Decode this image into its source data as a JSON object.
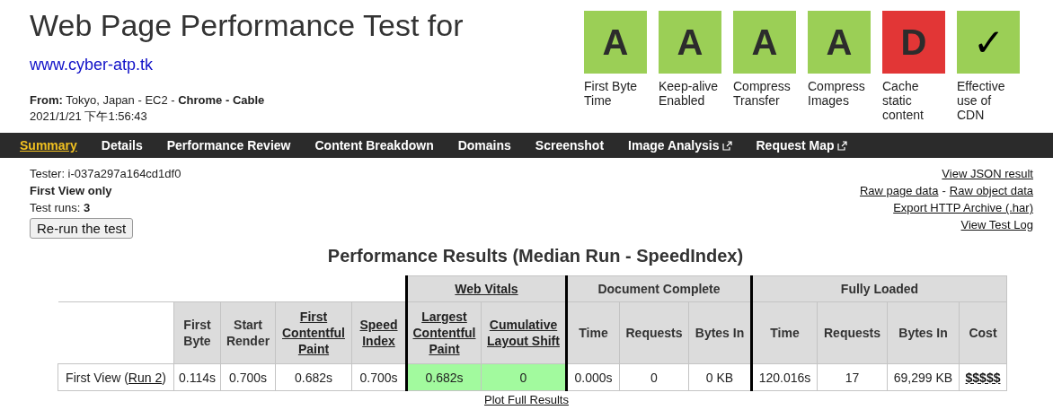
{
  "header": {
    "title": "Web Page Performance Test for",
    "url": "www.cyber-atp.tk",
    "from": "**From:** Tokyo, Japan - EC2 - **Chrome - Cable**",
    "date": "2021/1/21 下午1:56:43"
  },
  "grades": [
    {
      "symbol": "A",
      "label": "First Byte Time",
      "color": "#9bcf56"
    },
    {
      "symbol": "A",
      "label": "Keep-alive Enabled",
      "color": "#9bcf56"
    },
    {
      "symbol": "A",
      "label": "Compress Transfer",
      "color": "#9bcf56"
    },
    {
      "symbol": "A",
      "label": "Compress Images",
      "color": "#9bcf56"
    },
    {
      "symbol": "D",
      "label": "Cache static content",
      "color": "#e23636"
    },
    {
      "symbol": "✓",
      "label": "Effective use of CDN",
      "color": "#9bcf56"
    }
  ],
  "tabs": [
    {
      "label": "Summary",
      "selected": true,
      "external": false
    },
    {
      "label": "Details",
      "selected": false,
      "external": false
    },
    {
      "label": "Performance Review",
      "selected": false,
      "external": false
    },
    {
      "label": "Content Breakdown",
      "selected": false,
      "external": false
    },
    {
      "label": "Domains",
      "selected": false,
      "external": false
    },
    {
      "label": "Screenshot",
      "selected": false,
      "external": false
    },
    {
      "label": "Image Analysis",
      "selected": false,
      "external": true
    },
    {
      "label": "Request Map",
      "selected": false,
      "external": true
    }
  ],
  "info": {
    "tester": "Tester: i-037a297a164cd1df0",
    "view": "First View only",
    "runs": "Test runs: **3**",
    "button": "Re-run the test"
  },
  "links": [
    [
      "View JSON result"
    ],
    [
      "Raw page data",
      "Raw object data"
    ],
    [
      "Export HTTP Archive (.har)"
    ],
    [
      "View Test Log"
    ]
  ],
  "link_separator": "-",
  "results": {
    "title": "Performance Results (Median Run - SpeedIndex)",
    "columns": [
      {
        "label": "First Byte",
        "link": false
      },
      {
        "label": "Start Render",
        "link": false
      },
      {
        "label": "First Contentful Paint",
        "link": true
      },
      {
        "label": "Speed Index",
        "link": true
      }
    ],
    "groups": [
      {
        "label": "Web Vitals",
        "link": true,
        "columns": [
          {
            "label": "Largest Contentful Paint",
            "link": true
          },
          {
            "label": "Cumulative Layout Shift",
            "link": true
          }
        ]
      },
      {
        "label": "Document Complete",
        "link": false,
        "columns": [
          {
            "label": "Time",
            "link": false
          },
          {
            "label": "Requests",
            "link": false
          },
          {
            "label": "Bytes In",
            "link": false
          }
        ]
      },
      {
        "label": "Fully Loaded",
        "link": false,
        "columns": [
          {
            "label": "Time",
            "link": false
          },
          {
            "label": "Requests",
            "link": false
          },
          {
            "label": "Bytes In",
            "link": false
          },
          {
            "label": "Cost",
            "link": false
          }
        ]
      }
    ],
    "rows": [
      {
        "label_prefix": "First View (",
        "label_link": "Run 2",
        "label_suffix": ")",
        "cells": [
          {
            "value": "0.114s",
            "highlight": false,
            "link": false
          },
          {
            "value": "0.700s",
            "highlight": false,
            "link": false
          },
          {
            "value": "0.682s",
            "highlight": false,
            "link": false
          },
          {
            "value": "0.700s",
            "highlight": false,
            "link": false
          },
          {
            "value": "0.682s",
            "highlight": true,
            "link": false
          },
          {
            "value": "0",
            "highlight": true,
            "link": false
          },
          {
            "value": "0.000s",
            "highlight": false,
            "link": false
          },
          {
            "value": "0",
            "highlight": false,
            "link": false
          },
          {
            "value": "0 KB",
            "highlight": false,
            "link": false
          },
          {
            "value": "120.016s",
            "highlight": false,
            "link": false
          },
          {
            "value": "17",
            "highlight": false,
            "link": false
          },
          {
            "value": "69,299 KB",
            "highlight": false,
            "link": false
          },
          {
            "value": "$$$$$",
            "highlight": false,
            "link": true
          }
        ]
      }
    ],
    "plot_link": "Plot Full Results"
  }
}
